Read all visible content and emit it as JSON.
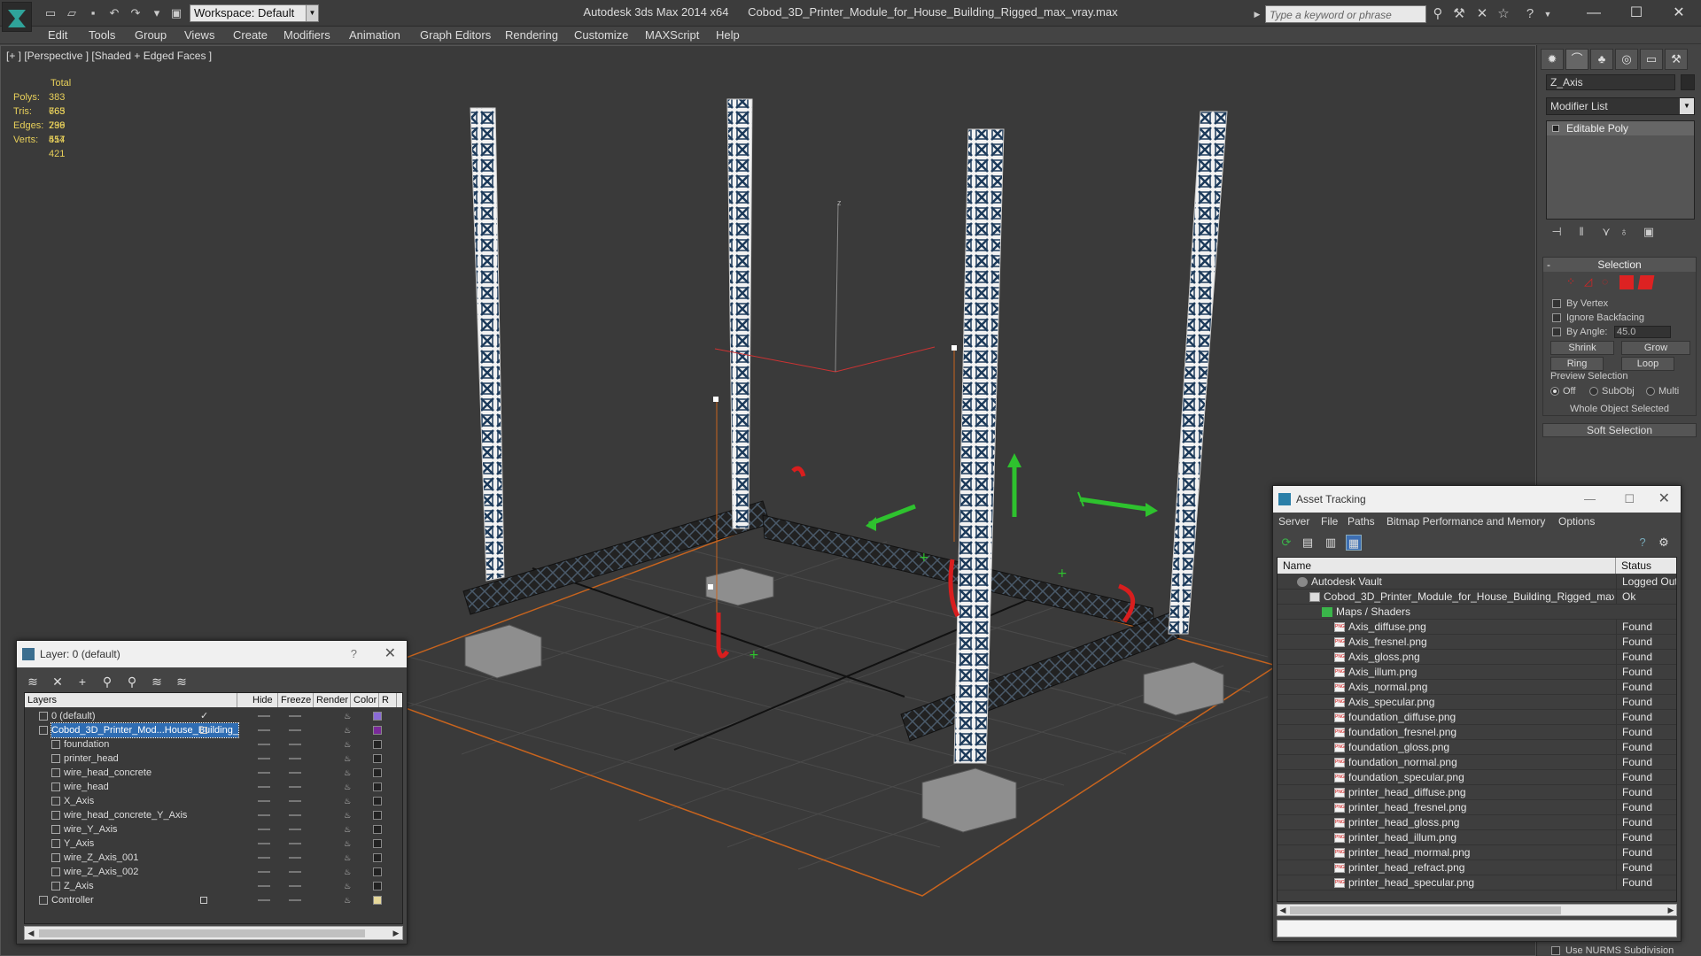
{
  "titlebar": {
    "workspace": "Workspace: Default",
    "app_name": "Autodesk 3ds Max  2014 x64",
    "file_name": "Cobod_3D_Printer_Module_for_House_Building_Rigged_max_vray.max",
    "search_placeholder": "Type a keyword or phrase"
  },
  "menu": [
    "Edit",
    "Tools",
    "Group",
    "Views",
    "Create",
    "Modifiers",
    "Animation",
    "Graph Editors",
    "Rendering",
    "Customize",
    "MAXScript",
    "Help"
  ],
  "viewport": {
    "label": "[+ ] [Perspective ] [Shaded + Edged Faces ]",
    "stats": {
      "header": "Total",
      "rows": [
        {
          "label": "Polys:",
          "value": "383 665"
        },
        {
          "label": "Tris:",
          "value": "763 236"
        },
        {
          "label": "Edges:",
          "value": "799 554"
        },
        {
          "label": "Verts:",
          "value": "417 421"
        }
      ]
    },
    "axis_label": "z"
  },
  "command_panel": {
    "object_name": "Z_Axis",
    "modifier_list": "Modifier List",
    "stack_item": "Editable Poly",
    "selection_title": "Selection",
    "by_vertex": "By Vertex",
    "ignore_backfacing": "Ignore Backfacing",
    "by_angle": "By Angle:",
    "angle_value": "45.0",
    "shrink": "Shrink",
    "grow": "Grow",
    "ring": "Ring",
    "loop": "Loop",
    "preview_selection": "Preview Selection",
    "radio_off": "Off",
    "radio_subobj": "SubObj",
    "radio_multi": "Multi",
    "whole_object": "Whole Object Selected",
    "soft_selection": "Soft Selection",
    "nurms": "Use NURMS Subdivision"
  },
  "layer_dialog": {
    "title": "Layer: 0 (default)",
    "help": "?",
    "columns": [
      "Layers",
      "Hide",
      "Freeze",
      "Render",
      "Color",
      "R"
    ],
    "rows": [
      {
        "name": "0 (default)",
        "level": 0,
        "color": "#8a6bd6",
        "check": true
      },
      {
        "name": "Cobod_3D_Printer_Mod...House_Building_",
        "level": 0,
        "color": "#7a2a9a",
        "selected": true
      },
      {
        "name": "foundation",
        "level": 1,
        "color": "#222222"
      },
      {
        "name": "printer_head",
        "level": 1,
        "color": "#222222"
      },
      {
        "name": "wire_head_concrete",
        "level": 1,
        "color": "#222222"
      },
      {
        "name": "wire_head",
        "level": 1,
        "color": "#222222"
      },
      {
        "name": "X_Axis",
        "level": 1,
        "color": "#222222"
      },
      {
        "name": "wire_head_concrete_Y_Axis",
        "level": 1,
        "color": "#222222"
      },
      {
        "name": "wire_Y_Axis",
        "level": 1,
        "color": "#222222"
      },
      {
        "name": "Y_Axis",
        "level": 1,
        "color": "#222222"
      },
      {
        "name": "wire_Z_Axis_001",
        "level": 1,
        "color": "#222222"
      },
      {
        "name": "wire_Z_Axis_002",
        "level": 1,
        "color": "#222222"
      },
      {
        "name": "Z_Axis",
        "level": 1,
        "color": "#222222"
      },
      {
        "name": "Controller",
        "level": 0,
        "color": "#e6d89a"
      }
    ]
  },
  "asset_dialog": {
    "title": "Asset Tracking",
    "menu": [
      "Server",
      "File",
      "Paths",
      "Bitmap Performance and Memory",
      "Options"
    ],
    "col_name": "Name",
    "col_status": "Status",
    "rows": [
      {
        "name": "Autodesk Vault",
        "status": "Logged Out",
        "indent": 1,
        "kind": "vault"
      },
      {
        "name": "Cobod_3D_Printer_Module_for_House_Building_Rigged_max...",
        "status": "Ok",
        "indent": 2,
        "kind": "max"
      },
      {
        "name": "Maps / Shaders",
        "status": "",
        "indent": 3,
        "kind": "maps"
      },
      {
        "name": "Axis_diffuse.png",
        "status": "Found",
        "indent": 4,
        "kind": "png"
      },
      {
        "name": "Axis_fresnel.png",
        "status": "Found",
        "indent": 4,
        "kind": "png"
      },
      {
        "name": "Axis_gloss.png",
        "status": "Found",
        "indent": 4,
        "kind": "png"
      },
      {
        "name": "Axis_illum.png",
        "status": "Found",
        "indent": 4,
        "kind": "png"
      },
      {
        "name": "Axis_normal.png",
        "status": "Found",
        "indent": 4,
        "kind": "png"
      },
      {
        "name": "Axis_specular.png",
        "status": "Found",
        "indent": 4,
        "kind": "png"
      },
      {
        "name": "foundation_diffuse.png",
        "status": "Found",
        "indent": 4,
        "kind": "png"
      },
      {
        "name": "foundation_fresnel.png",
        "status": "Found",
        "indent": 4,
        "kind": "png"
      },
      {
        "name": "foundation_gloss.png",
        "status": "Found",
        "indent": 4,
        "kind": "png"
      },
      {
        "name": "foundation_normal.png",
        "status": "Found",
        "indent": 4,
        "kind": "png"
      },
      {
        "name": "foundation_specular.png",
        "status": "Found",
        "indent": 4,
        "kind": "png"
      },
      {
        "name": "printer_head_diffuse.png",
        "status": "Found",
        "indent": 4,
        "kind": "png"
      },
      {
        "name": "printer_head_fresnel.png",
        "status": "Found",
        "indent": 4,
        "kind": "png"
      },
      {
        "name": "printer_head_gloss.png",
        "status": "Found",
        "indent": 4,
        "kind": "png"
      },
      {
        "name": "printer_head_illum.png",
        "status": "Found",
        "indent": 4,
        "kind": "png"
      },
      {
        "name": "printer_head_mormal.png",
        "status": "Found",
        "indent": 4,
        "kind": "png"
      },
      {
        "name": "printer_head_refract.png",
        "status": "Found",
        "indent": 4,
        "kind": "png"
      },
      {
        "name": "printer_head_specular.png",
        "status": "Found",
        "indent": 4,
        "kind": "png"
      }
    ]
  },
  "colors": {
    "stats_text": "#e8d05a",
    "selection_blue": "#2f6db3",
    "gizmo_green": "#2ec22e",
    "gizmo_red": "#d81e1e",
    "grid_orange": "#c8641e"
  }
}
